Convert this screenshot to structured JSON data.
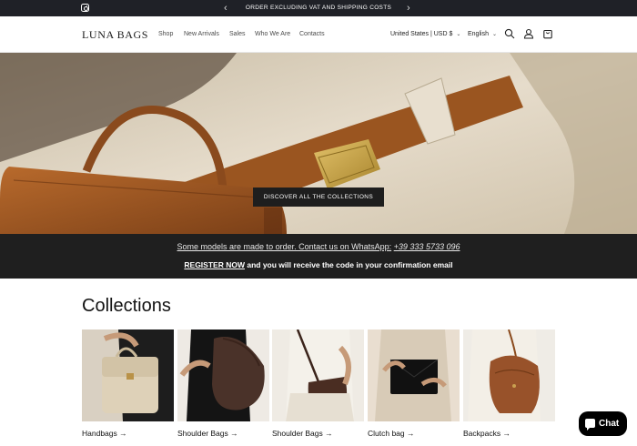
{
  "announcement": {
    "message": "ORDER EXCLUDING VAT AND SHIPPING COSTS",
    "prev_icon": "chevron-left-icon",
    "next_icon": "chevron-right-icon",
    "social_icon": "instagram-icon"
  },
  "header": {
    "logo": "LUNA BAGS",
    "nav": [
      "Shop",
      "New Arrivals",
      "Sales",
      "Who We Are",
      "Contacts"
    ],
    "country": "United States | USD $",
    "language": "English",
    "icons": [
      "search-icon",
      "account-icon",
      "cart-icon"
    ]
  },
  "hero": {
    "button": "DISCOVER ALL THE COLLECTIONS"
  },
  "info_band": {
    "line1_link": "Some models are made to order. Contact us on WhatsApp:",
    "line1_phone": "+39 333 5733 096",
    "line2_link": "REGISTER NOW",
    "line2_rest": " and you will receive the code in your confirmation email"
  },
  "collections": {
    "title": "Collections",
    "items": [
      {
        "label": "Handbags →"
      },
      {
        "label": "Shoulder Bags →"
      },
      {
        "label": "Shoulder Bags →"
      },
      {
        "label": "Clutch bag →"
      },
      {
        "label": "Backpacks →"
      }
    ]
  },
  "chat": {
    "label": "Chat"
  },
  "colors": {
    "announcement_bg": "#1f2127",
    "band_bg": "#1f1f1f",
    "leather_brown": "#a35a24",
    "cream": "#e8e0d0"
  }
}
